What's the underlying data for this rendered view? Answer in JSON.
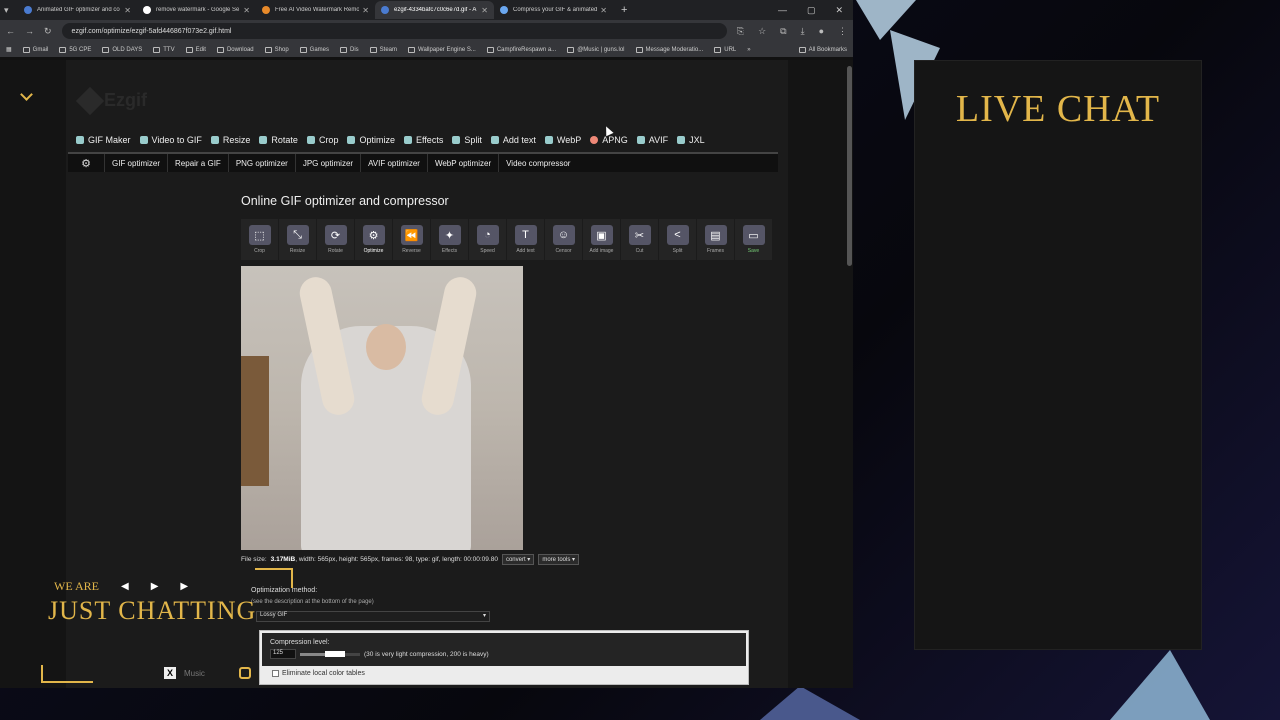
{
  "browser": {
    "tabs": [
      {
        "title": "Animated GIF optimizer and co",
        "active": false,
        "color": "#4a7bd0"
      },
      {
        "title": "remove watermark - Google Se",
        "active": false,
        "color": "#ffffff"
      },
      {
        "title": "Free AI Video Watermark Remo",
        "active": false,
        "color": "#e88a2a"
      },
      {
        "title": "ezgif-4334bafc7c0c6e7d.gif - A",
        "active": true,
        "color": "#4a7bd0"
      },
      {
        "title": "Compress your GIF & animated",
        "active": false,
        "color": "#6aa7f0"
      }
    ],
    "url": "ezgif.com/optimize/ezgif-5afd446867f073e2.gif.html",
    "bookmarks": [
      "Gmail",
      "5G CPE",
      "OLD DAYS",
      "TTV",
      "Edit",
      "Download",
      "Shop",
      "Games",
      "Dis",
      "Steam",
      "Wallpaper Engine S...",
      "CampfireRespawn a...",
      "@Music | guns.lol",
      "Message Moderatio...",
      "URL"
    ],
    "all_bookmarks": "All Bookmarks"
  },
  "site": {
    "logo": "Ezgif",
    "main_nav": [
      "GIF Maker",
      "Video to GIF",
      "Resize",
      "Rotate",
      "Crop",
      "Optimize",
      "Effects",
      "Split",
      "Add text",
      "WebP",
      "APNG",
      "AVIF",
      "JXL"
    ],
    "sub_nav": [
      "GIF optimizer",
      "Repair a GIF",
      "PNG optimizer",
      "JPG optimizer",
      "AVIF optimizer",
      "WebP optimizer",
      "Video compressor"
    ],
    "page_title": "Online GIF optimizer and compressor",
    "tools": [
      {
        "label": "Crop",
        "icon": "crop-icon",
        "glyph": "⬚"
      },
      {
        "label": "Resize",
        "icon": "resize-icon",
        "glyph": "⤡"
      },
      {
        "label": "Rotate",
        "icon": "rotate-icon",
        "glyph": "⟳"
      },
      {
        "label": "Optimize",
        "icon": "optimize-icon",
        "glyph": "⚙"
      },
      {
        "label": "Reverse",
        "icon": "reverse-icon",
        "glyph": "⏪"
      },
      {
        "label": "Effects",
        "icon": "effects-icon",
        "glyph": "✦"
      },
      {
        "label": "Speed",
        "icon": "speed-icon",
        "glyph": "◔"
      },
      {
        "label": "Add text",
        "icon": "add-text-icon",
        "glyph": "T"
      },
      {
        "label": "Censor",
        "icon": "censor-icon",
        "glyph": "☺"
      },
      {
        "label": "Add image",
        "icon": "add-image-icon",
        "glyph": "▣"
      },
      {
        "label": "Cut",
        "icon": "cut-icon",
        "glyph": "✂"
      },
      {
        "label": "Split",
        "icon": "split-icon",
        "glyph": "<"
      },
      {
        "label": "Frames",
        "icon": "frames-icon",
        "glyph": "▤"
      },
      {
        "label": "Save",
        "icon": "save-icon",
        "glyph": "▭"
      }
    ],
    "file_info": {
      "prefix": "File size:",
      "size": "3.17MiB",
      "rest": ", width: 565px, height: 565px, frames: 98, type: gif, length: 00:00:09.80"
    },
    "convert_label": "convert",
    "more_tools_label": "more tools",
    "optimization_method_label": "Optimization method:",
    "optimization_hint": "(see the description at the bottom of the page)",
    "optimization_value": "Lossy GIF",
    "compression_level_label": "Compression level:",
    "compression_value": "125",
    "compression_fraction": 0.58,
    "compression_hint": "(30 is very light compression, 200 is heavy)",
    "eliminate_label": "Eliminate local color tables"
  },
  "overlay": {
    "we_are": "WE ARE",
    "just_chatting": "JUST CHATTING",
    "music": "Music",
    "live_chat": "LIVE CHAT"
  },
  "colors": {
    "accent": "#e2b64a"
  }
}
